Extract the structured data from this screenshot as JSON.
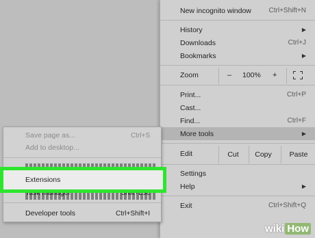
{
  "main_menu": {
    "new_incognito": {
      "label": "New incognito window",
      "shortcut": "Ctrl+Shift+N"
    },
    "history": {
      "label": "History"
    },
    "downloads": {
      "label": "Downloads",
      "shortcut": "Ctrl+J"
    },
    "bookmarks": {
      "label": "Bookmarks"
    },
    "zoom": {
      "label": "Zoom",
      "minus": "–",
      "value": "100%",
      "plus": "+"
    },
    "print": {
      "label": "Print...",
      "shortcut": "Ctrl+P"
    },
    "cast": {
      "label": "Cast..."
    },
    "find": {
      "label": "Find...",
      "shortcut": "Ctrl+F"
    },
    "more_tools": {
      "label": "More tools"
    },
    "edit": {
      "label": "Edit",
      "cut": "Cut",
      "copy": "Copy",
      "paste": "Paste"
    },
    "settings": {
      "label": "Settings"
    },
    "help": {
      "label": "Help"
    },
    "exit": {
      "label": "Exit",
      "shortcut": "Ctrl+Shift+Q"
    }
  },
  "sub_menu": {
    "save_page": {
      "label": "Save page as...",
      "shortcut": "Ctrl+S"
    },
    "add_desktop": {
      "label": "Add to desktop..."
    },
    "extensions": {
      "label": "Extensions"
    },
    "task_manager": {
      "label": "Task manager",
      "shortcut": "Shift+Esc"
    },
    "developer_tools": {
      "label": "Developer tools",
      "shortcut": "Ctrl+Shift+I"
    }
  },
  "watermark": {
    "wiki": "wiki",
    "how": "How"
  },
  "colors": {
    "highlight": "#2ee52e",
    "menu_bg": "#d0d0d0"
  }
}
